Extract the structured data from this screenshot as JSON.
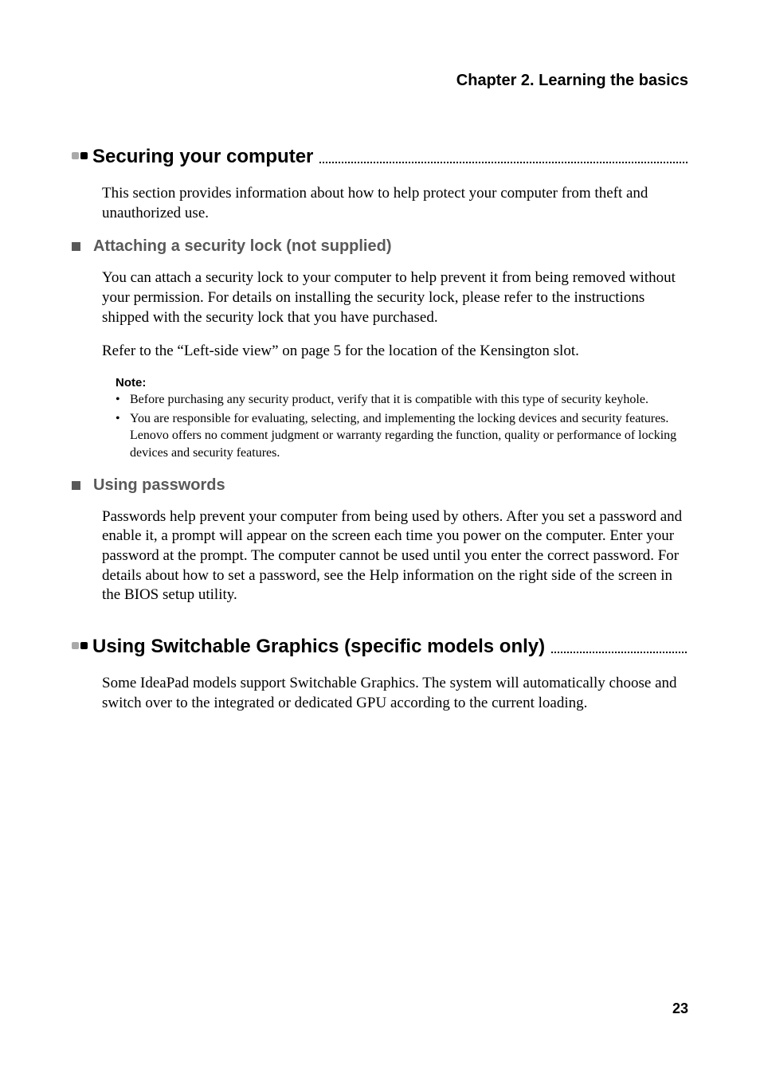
{
  "chapter": "Chapter 2. Learning the basics",
  "section1": {
    "title": "Securing your computer",
    "intro": "This section provides information about how to help protect your computer from theft and unauthorized use.",
    "sub1": {
      "title": "Attaching a security lock (not supplied)",
      "p1": "You can attach a security lock to your computer to help prevent it from being removed without your permission. For details on installing the security lock, please refer to the instructions shipped with the security lock that you have purchased.",
      "p2": "Refer to the “Left-side view” on page 5 for the location of the Kensington slot.",
      "note_label": "Note:",
      "note1": "Before purchasing any security product, verify that it is compatible with this type of security keyhole.",
      "note2": "You are responsible for evaluating, selecting, and implementing the locking devices and security features. Lenovo offers no comment judgment or warranty regarding the function, quality or performance of locking devices and security features."
    },
    "sub2": {
      "title": "Using passwords",
      "p1": "Passwords help prevent your computer from being used by others. After you set a password and enable it, a prompt will appear on the screen each time you power on the computer. Enter your password at the prompt. The computer cannot be used until you enter the correct password. For details about how to set a password, see the Help information on the right side of the screen in the BIOS setup utility."
    }
  },
  "section2": {
    "title": "Using Switchable Graphics (specific models only)",
    "p1": "Some IdeaPad models support Switchable Graphics. The system will automatically choose and switch over to the integrated or dedicated GPU according to the current loading."
  },
  "page_number": "23"
}
